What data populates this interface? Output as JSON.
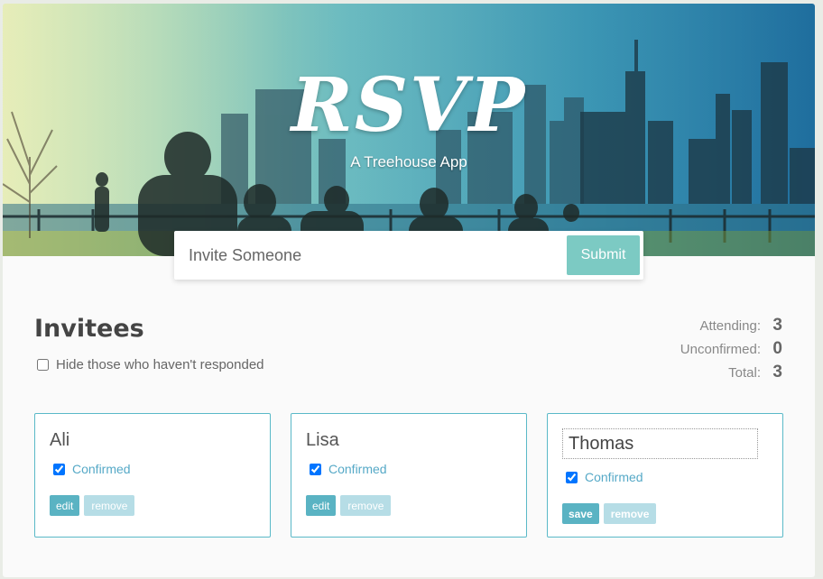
{
  "header": {
    "title": "RSVP",
    "subtitle": "A Treehouse App"
  },
  "invite_form": {
    "placeholder": "Invite Someone",
    "submit_label": "Submit"
  },
  "main": {
    "section_title": "Invitees",
    "filter_label": "Hide those who haven't responded"
  },
  "counter": {
    "attending_label": "Attending:",
    "attending_value": "3",
    "unconfirmed_label": "Unconfirmed:",
    "unconfirmed_value": "0",
    "total_label": "Total:",
    "total_value": "3"
  },
  "invitees": [
    {
      "name": "Ali",
      "confirmed_label": "Confirmed",
      "confirmed": true,
      "edit_label": "edit",
      "remove_label": "remove",
      "editing": false
    },
    {
      "name": "Lisa",
      "confirmed_label": "Confirmed",
      "confirmed": true,
      "edit_label": "edit",
      "remove_label": "remove",
      "editing": false
    },
    {
      "name": "Thomas",
      "confirmed_label": "Confirmed",
      "confirmed": true,
      "save_label": "save",
      "remove_label": "remove",
      "editing": true
    }
  ],
  "colors": {
    "accent": "#5ab3c3",
    "submit": "#7ccac3",
    "remove": "#b6dde6",
    "confirmed_text": "#56a9c7"
  }
}
